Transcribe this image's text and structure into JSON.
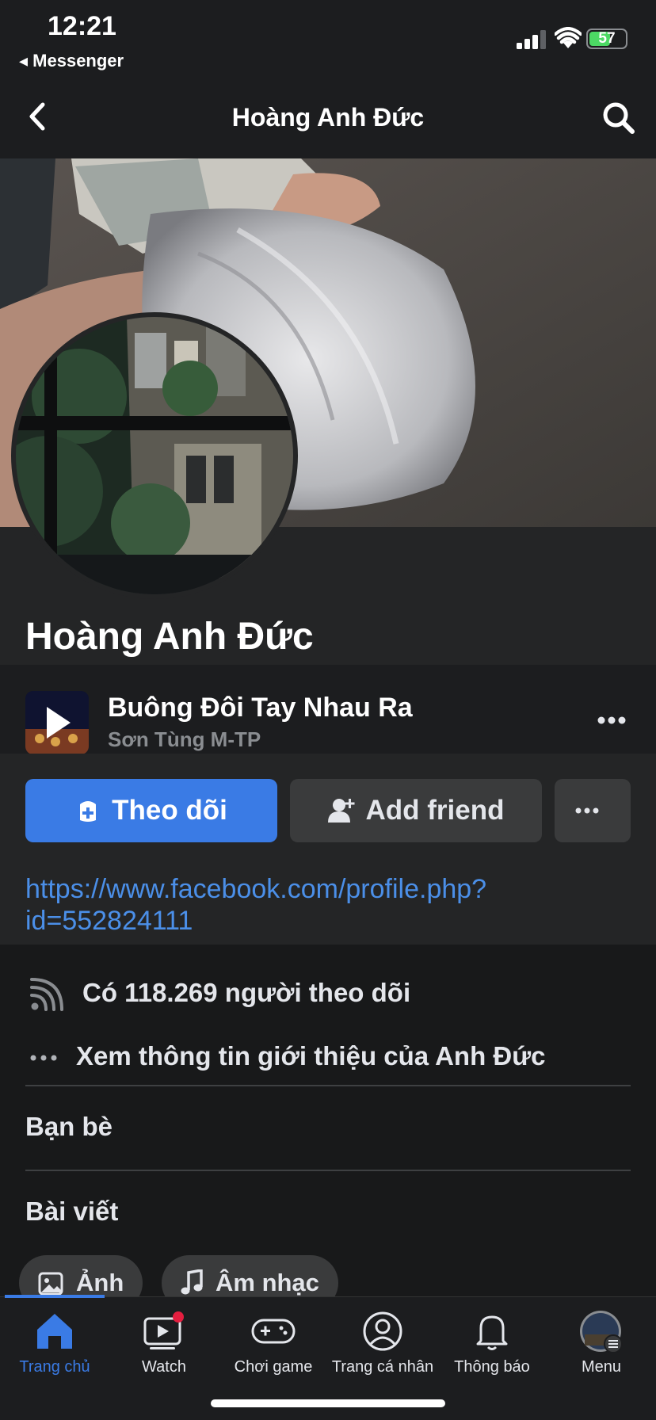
{
  "status_bar": {
    "time": "12:21",
    "back_app": "◂ Messenger",
    "battery": "57"
  },
  "nav": {
    "title": "Hoàng Anh Đức"
  },
  "profile": {
    "name": "Hoàng Anh Đức"
  },
  "music": {
    "song_title": "Buông Đôi Tay Nhau Ra",
    "artist": "Sơn Tùng M-TP"
  },
  "actions": {
    "follow_label": "Theo dõi",
    "add_friend_label": "Add friend"
  },
  "link": {
    "url_line1": "https://www.facebook.com/profile.php?",
    "url_line2": "id=552824111"
  },
  "info": {
    "followers": "Có 118.269 người theo dõi",
    "about": "Xem thông tin giới thiệu của Anh Đức"
  },
  "sections": {
    "friends": "Bạn bè",
    "posts": "Bài viết"
  },
  "chips": {
    "photos": "Ảnh",
    "music": "Âm nhạc"
  },
  "tabs": [
    {
      "label": "Trang chủ"
    },
    {
      "label": "Watch"
    },
    {
      "label": "Chơi game"
    },
    {
      "label": "Trang cá nhân"
    },
    {
      "label": "Thông báo"
    },
    {
      "label": "Menu"
    }
  ],
  "colors": {
    "accent": "#3a7be5",
    "link": "#4b8fe8",
    "background": "#18191a",
    "surface": "#242526",
    "notification_dot": "#e41e3f"
  },
  "icons": [
    "chevron-left-icon",
    "search-icon",
    "more-icon",
    "follow-icon",
    "add-friend-icon",
    "rss-icon",
    "dots-icon",
    "photo-icon",
    "music-note-icon",
    "home-icon",
    "watch-icon",
    "gaming-icon",
    "profile-icon",
    "bell-icon",
    "menu-avatar-icon"
  ]
}
